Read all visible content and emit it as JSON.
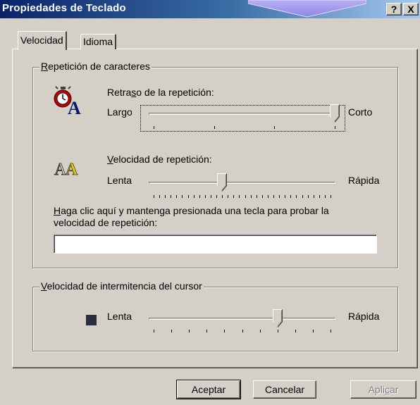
{
  "window": {
    "title": "Propiedades de Teclado",
    "help_button": "?",
    "close_button": "X"
  },
  "tabs": [
    {
      "label": "Velocidad",
      "active": true
    },
    {
      "label": "Idioma",
      "active": false
    }
  ],
  "repeat_group": {
    "legend_key": "R",
    "legend_rest": "epetición de caracteres",
    "delay": {
      "label_pre": "Retra",
      "label_key": "s",
      "label_post": "o de la repetición:",
      "left_label": "Largo",
      "right_label": "Corto",
      "value": 3,
      "max": 3,
      "icon": "stopwatch-icon"
    },
    "rate": {
      "label_key": "V",
      "label_rest": "elocidad de repetición:",
      "left_label": "Lenta",
      "right_label": "Rápida",
      "value": 12,
      "max": 31,
      "icon": "keyboard-letters-icon",
      "icon_text": "AA"
    },
    "test_label_key": "H",
    "test_label_line1_rest": "aga clic aquí y mantenga presionada una tecla para probar la",
    "test_label_line2": "velocidad de repetición:",
    "test_value": ""
  },
  "cursor_group": {
    "legend_key": "V",
    "legend_rest": "elocidad de intermitencia del cursor",
    "left_label": "Lenta",
    "right_label": "Rápida",
    "value": 7,
    "max": 10,
    "icon": "cursor-block-icon"
  },
  "buttons": {
    "ok": "Aceptar",
    "cancel": "Cancelar",
    "apply_pre": "Apli",
    "apply_key": "c",
    "apply_post": "ar"
  }
}
